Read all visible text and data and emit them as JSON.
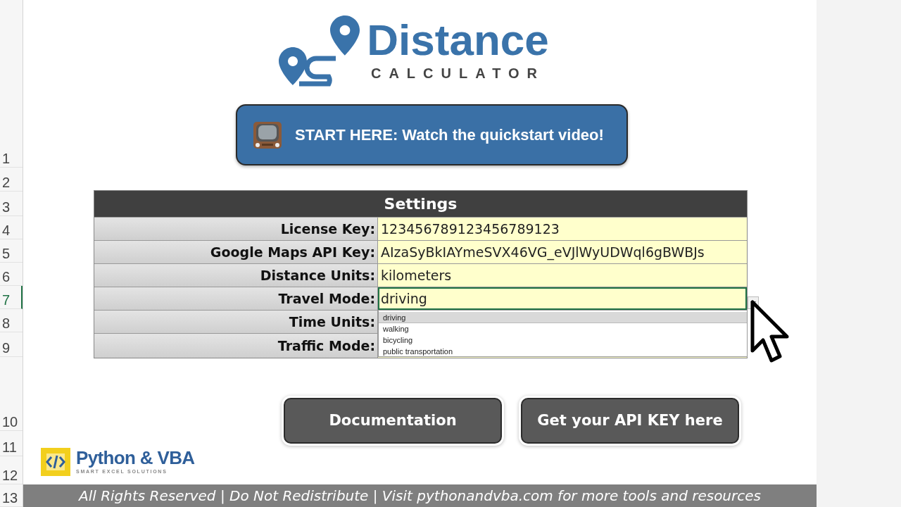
{
  "logo": {
    "title": "Distance",
    "subtitle": "CALCULATOR"
  },
  "video_button": {
    "label": "START HERE: Watch the quickstart video!"
  },
  "row_numbers": [
    {
      "label": "1",
      "selected": false
    },
    {
      "label": "2",
      "selected": false
    },
    {
      "label": "3",
      "selected": false
    },
    {
      "label": "4",
      "selected": false
    },
    {
      "label": "5",
      "selected": false
    },
    {
      "label": "6",
      "selected": false
    },
    {
      "label": "7",
      "selected": true
    },
    {
      "label": "8",
      "selected": false
    },
    {
      "label": "9",
      "selected": false
    },
    {
      "label": "10",
      "selected": false
    },
    {
      "label": "11",
      "selected": false
    },
    {
      "label": "12",
      "selected": false
    },
    {
      "label": "13",
      "selected": false
    }
  ],
  "settings": {
    "title": "Settings",
    "rows": [
      {
        "label": "License Key:",
        "value": "123456789123456789123",
        "selected": false
      },
      {
        "label": "Google Maps API Key:",
        "value": "AIzaSyBkIAYmeSVX46VG_eVJlWyUDWql6gBWBJs",
        "selected": false
      },
      {
        "label": "Distance Units:",
        "value": "kilometers",
        "selected": false
      },
      {
        "label": "Travel Mode:",
        "value": "driving",
        "selected": true
      },
      {
        "label": "Time Units:"
      },
      {
        "label": "Traffic Mode:"
      }
    ]
  },
  "dropdown": {
    "options": [
      {
        "label": "driving",
        "selected": true
      },
      {
        "label": "walking",
        "selected": false
      },
      {
        "label": "bicycling",
        "selected": false
      },
      {
        "label": "public transportation",
        "selected": false
      }
    ]
  },
  "buttons": [
    "Documentation",
    "Get your API KEY here"
  ],
  "brand": {
    "name": "Python & VBA",
    "tagline": "SMART EXCEL SOLUTIONS"
  },
  "footer": "All Rights Reserved | Do Not Redistribute | Visit pythonandvba.com for more tools and resources"
}
